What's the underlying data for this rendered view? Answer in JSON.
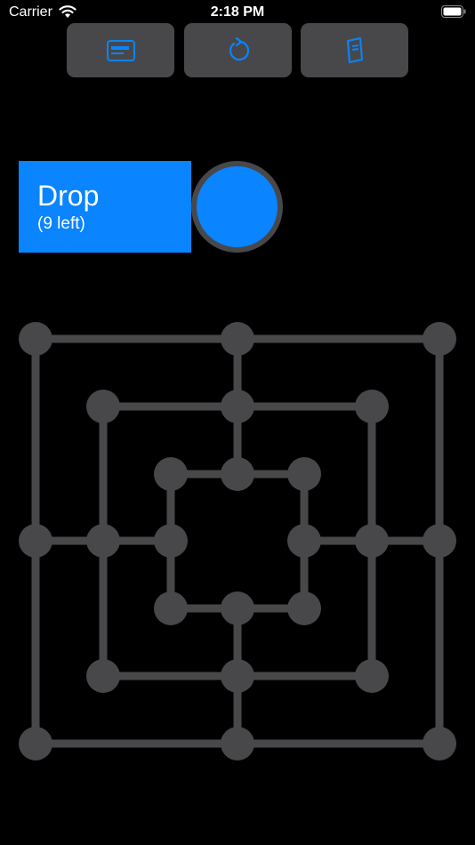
{
  "status_bar": {
    "carrier": "Carrier",
    "time": "2:18 PM"
  },
  "toolbar": {
    "buttons": [
      {
        "name": "status-button",
        "icon": "card-icon"
      },
      {
        "name": "undo-button",
        "icon": "undo-icon"
      },
      {
        "name": "rules-button",
        "icon": "book-icon"
      }
    ]
  },
  "game": {
    "action": "Drop",
    "remaining": "(9 left)",
    "current_player_color": "#0a84ff"
  },
  "colors": {
    "accent": "#0a84ff",
    "board": "#48484a",
    "background": "#000000"
  }
}
